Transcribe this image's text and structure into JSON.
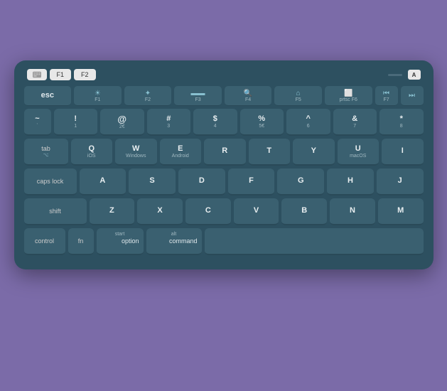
{
  "keyboard": {
    "color": "#2D5060",
    "rows": {
      "fn_row": [
        "esc",
        "F1",
        "F2",
        "F3",
        "F4",
        "F5",
        "F6",
        "F7"
      ],
      "number_row": [
        "~`",
        "!1",
        "@2€",
        "#3",
        "$4",
        "%5€",
        "^6",
        "&7",
        "*8"
      ],
      "qwerty_row": [
        "tab",
        "Q",
        "W",
        "E",
        "R",
        "T",
        "Y",
        "U",
        "I"
      ],
      "home_row": [
        "caps lock",
        "A",
        "S",
        "D",
        "F",
        "G",
        "H",
        "J"
      ],
      "shift_row": [
        "shift",
        "Z",
        "X",
        "C",
        "V",
        "B",
        "N",
        "M"
      ],
      "bottom_row": [
        "control",
        "fn",
        "option",
        "command",
        "space"
      ]
    },
    "labels": {
      "esc": "esc",
      "tab": "tab",
      "caps_lock": "caps lock",
      "shift": "shift",
      "control": "control",
      "fn": "fn",
      "option_top": "start",
      "option_bottom": "option",
      "command_top": "alt",
      "command_bottom": "command",
      "ios": "iOS",
      "windows": "Windows",
      "android": "Android",
      "macos": "macOS"
    }
  }
}
